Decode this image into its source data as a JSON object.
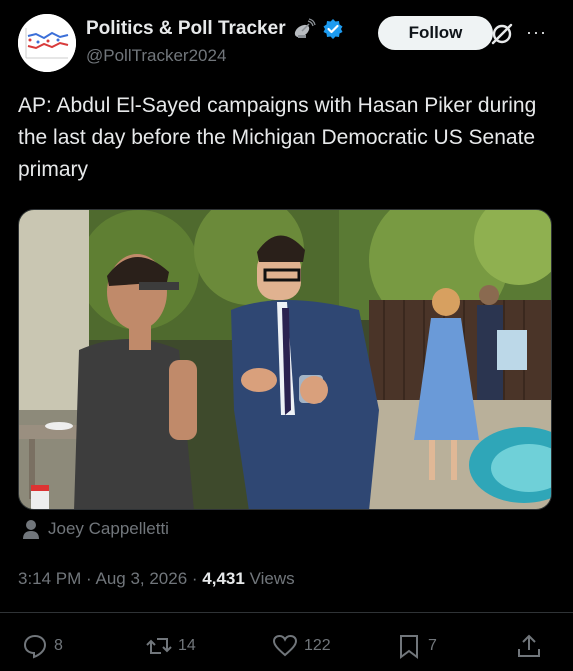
{
  "author": {
    "display_name": "Politics & Poll Tracker",
    "handle": "@PollTracker2024",
    "verified": true,
    "avatar_icon": "poll-chart-avatar-icon",
    "badge_icon": "satellite-dish-icon"
  },
  "follow_label": "Follow",
  "post": {
    "text": "AP: Abdul El-Sayed campaigns with Hasan Piker during the last day before the Michigan Democratic US Senate primary"
  },
  "media": {
    "credit": "Joey Cappelletti"
  },
  "meta": {
    "time": "3:14 PM",
    "date": "Aug 3, 2026",
    "views_count": "4,431",
    "views_label": "Views"
  },
  "actions": {
    "replies": "8",
    "reposts": "14",
    "likes": "122",
    "bookmarks": "7"
  },
  "colors": {
    "background": "#000000",
    "text": "#e7e9ea",
    "muted": "#71767b",
    "verified": "#1d9bf0",
    "follow_bg": "#eff3f4"
  }
}
